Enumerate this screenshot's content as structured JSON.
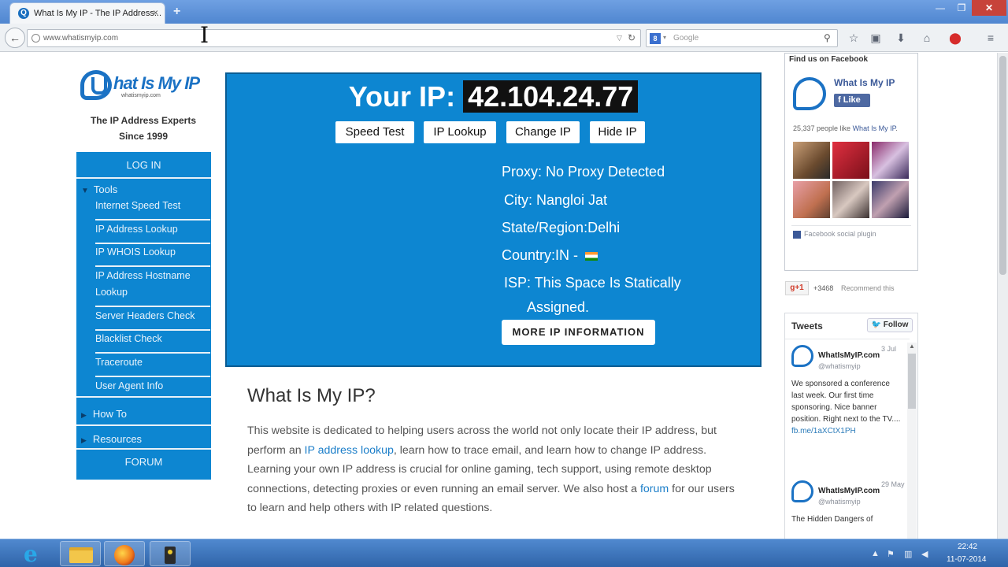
{
  "browser": {
    "tab_title": "What Is My IP - The IP Address...",
    "tab_close": "×",
    "new_tab": "+",
    "url": "www.whatismyip.com",
    "search_placeholder": "Google",
    "window_controls": {
      "minimize": "—",
      "maximize": "❐",
      "close": "✕"
    }
  },
  "logo": {
    "text": "hat Is My IP",
    "url_text": "whatismyip.com"
  },
  "tagline": [
    "The IP Address Experts",
    "Since 1999"
  ],
  "sidebar": {
    "login": "LOG IN",
    "tools_label": "Tools",
    "items": [
      "Internet Speed Test",
      "IP Address Lookup",
      "IP WHOIS Lookup",
      "IP Address Hostname Lookup",
      "Server Headers Check",
      "Blacklist Check",
      "Traceroute",
      "User Agent Info"
    ],
    "how_to": "How To",
    "resources": "Resources",
    "forum": "FORUM"
  },
  "hero": {
    "ip_label": "Your IP:",
    "ip_value": "42.104.24.77",
    "buttons": [
      "Speed Test",
      "IP Lookup",
      "Change IP",
      "Hide IP"
    ],
    "proxy": "Proxy: No Proxy Detected",
    "city": "City:  Nangloi Jat",
    "state": "State/Region:Delhi",
    "country": "Country:IN - ",
    "isp_line1": "ISP:  This Space Is Statically",
    "isp_line2": "Assigned.",
    "more_button": "MORE IP INFORMATION"
  },
  "article": {
    "title": "What Is My IP?",
    "body_pre": "This website is dedicated to helping users across the world not only locate their IP address, but perform an ",
    "link1": "IP address lookup",
    "body_mid": ", learn how to trace email, and learn how to change IP address. Learning your own IP address is crucial for online gaming, tech support, using remote desktop connections, detecting proxies or even running an email server. We also host a ",
    "link2": "forum",
    "body_post": " for our users to learn and help others with IP related questions."
  },
  "facebook": {
    "header": "Find us on Facebook",
    "page_name": "What Is My IP",
    "like": "Like",
    "count_text": "25,337 people like ",
    "count_link": "What Is My IP",
    "count_end": ".",
    "plugin": "Facebook social plugin"
  },
  "gplus": {
    "button": "g+1",
    "count": "+3468",
    "recommend": "Recommend this"
  },
  "twitter": {
    "title": "Tweets",
    "follow": "Follow",
    "tweets": [
      {
        "name": "WhatIsMyIP.com",
        "handle": "@whatismyip",
        "date": "3 Jul",
        "text": "We sponsored a conference last week.  Our first time sponsoring. Nice banner position. Right next to the TV....",
        "link": "fb.me/1aXCtX1PH"
      },
      {
        "name": "WhatIsMyIP.com",
        "handle": "@whatismyip",
        "date": "29 May",
        "text": "The Hidden Dangers of",
        "link": ""
      }
    ]
  },
  "taskbar": {
    "time": "22:42",
    "date": "11-07-2014"
  }
}
